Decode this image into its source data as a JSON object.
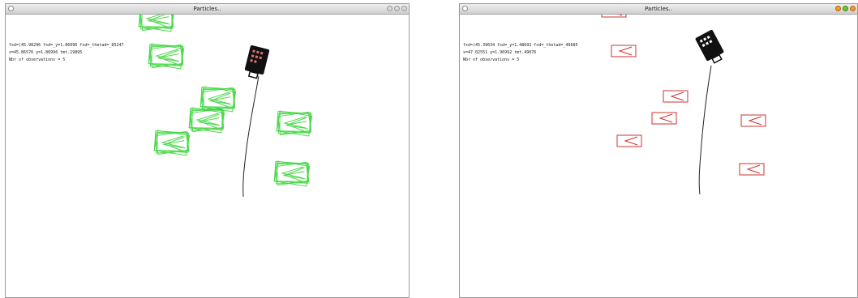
{
  "left_window": {
    "title": "Particles..",
    "info_line1": "fxd=(45.98296 fxd=_y=1.86996 fxd=_thetad=_85247",
    "info_line2": "x=45.86576 y=1.86996 tmt.19895",
    "info_line3": "Nbr of observations = 5",
    "particle_color": "#3ad43a"
  },
  "right_window": {
    "title": "Particles..",
    "info_line1": "fxd=(45.39634 fxd=_y=1.48692 fxd=_thetad=_46685",
    "info_line2": "x=47.02551 y=1.96992 tmt.49076",
    "info_line3": "Nbr of observations = 5",
    "particle_color": "#cc3333"
  }
}
